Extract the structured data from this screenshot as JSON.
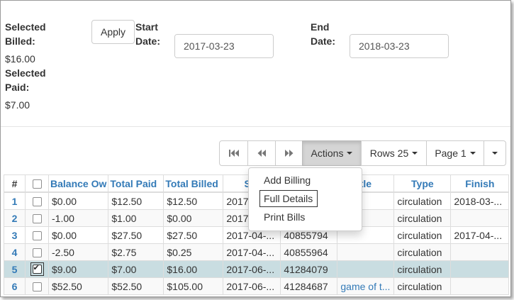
{
  "summary": {
    "selected_billed_label_1": "Selected",
    "selected_billed_label_2": "Billed:",
    "selected_billed_value": "$16.00",
    "selected_paid_label_1": "Selected",
    "selected_paid_label_2": "Paid:",
    "selected_paid_value": "$7.00"
  },
  "apply_label": "Apply",
  "start_date": {
    "label_1": "Start",
    "label_2": "Date:",
    "value": "2017-03-23"
  },
  "end_date": {
    "label_1": "End",
    "label_2": "Date:",
    "value": "2018-03-23"
  },
  "toolbar": {
    "first_icon": "first-page-icon",
    "prev_icon": "prev-page-icon",
    "next_icon": "next-page-icon",
    "actions_label": "Actions",
    "rows_label": "Rows 25",
    "page_label": "Page 1"
  },
  "actions_menu": {
    "items": [
      "Add Billing",
      "Full Details",
      "Print Bills"
    ],
    "focused": "Full Details"
  },
  "columns": [
    "#",
    "",
    "Balance Ow",
    "Total Paid",
    "Total Billed",
    "Sta",
    "",
    "tle",
    "Type",
    "Finish"
  ],
  "rows": [
    {
      "num": "1",
      "checked": false,
      "balance": "$0.00",
      "paid": "$12.50",
      "billed": "$12.50",
      "start": "2017-",
      "id": "",
      "title": "",
      "type": "circulation",
      "finish": "2018-03-..."
    },
    {
      "num": "2",
      "checked": false,
      "balance": "-1.00",
      "paid": "$1.00",
      "billed": "$0.00",
      "start": "2017-",
      "id": "",
      "title": "",
      "type": "circulation",
      "finish": ""
    },
    {
      "num": "3",
      "checked": false,
      "balance": "$0.00",
      "paid": "$27.50",
      "billed": "$27.50",
      "start": "2017-04-...",
      "id": "40855794",
      "title": "",
      "type": "circulation",
      "finish": "2017-04-..."
    },
    {
      "num": "4",
      "checked": false,
      "balance": "-2.50",
      "paid": "$2.75",
      "billed": "$0.25",
      "start": "2017-04-...",
      "id": "40855964",
      "title": "",
      "type": "circulation",
      "finish": ""
    },
    {
      "num": "5",
      "checked": true,
      "balance": "$9.00",
      "paid": "$7.00",
      "billed": "$16.00",
      "start": "2017-06-...",
      "id": "41284079",
      "title": "",
      "type": "circulation",
      "finish": ""
    },
    {
      "num": "6",
      "checked": false,
      "balance": "$52.50",
      "paid": "$52.50",
      "billed": "$105.00",
      "start": "2017-06-...",
      "id": "41284687",
      "title": "game of t...",
      "type": "circulation",
      "finish": ""
    }
  ]
}
